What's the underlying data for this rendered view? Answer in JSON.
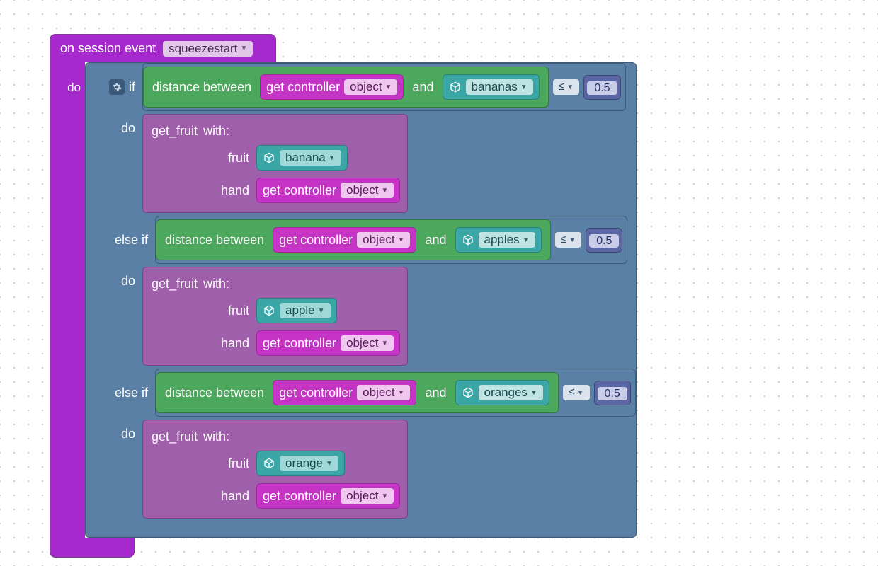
{
  "event": {
    "title": "on session event",
    "value": "squeezestart",
    "do_label": "do"
  },
  "logic": {
    "if_label": "if",
    "else_if_label": "else if",
    "do_label": "do"
  },
  "compare": {
    "operator": "≤",
    "threshold": "0.5"
  },
  "distance": {
    "label": "distance between",
    "and_label": "and"
  },
  "controller": {
    "label": "get controller",
    "param": "object"
  },
  "call": {
    "name": "get_fruit",
    "with_label": "with:",
    "arg1": "fruit",
    "arg2": "hand"
  },
  "branches": [
    {
      "target_plural": "bananas",
      "target_singular": "banana"
    },
    {
      "target_plural": "apples",
      "target_singular": "apple"
    },
    {
      "target_plural": "oranges",
      "target_singular": "orange"
    }
  ]
}
